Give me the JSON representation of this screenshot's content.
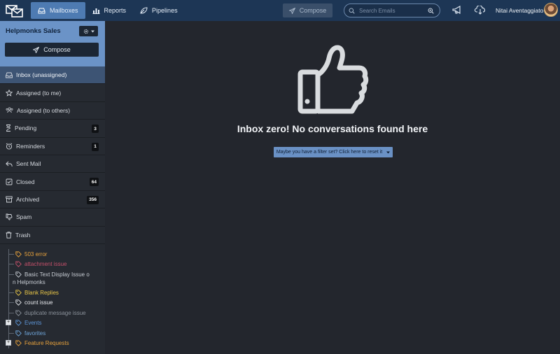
{
  "topbar": {
    "nav": [
      {
        "label": "Mailboxes",
        "icon": "inbox-icon",
        "active": true
      },
      {
        "label": "Reports",
        "icon": "bar-chart-icon",
        "active": false
      },
      {
        "label": "Pipelines",
        "icon": "leaf-icon",
        "active": false
      }
    ],
    "compose_label": "Compose",
    "search_placeholder": "Search Emails",
    "user_name": "Nitai Aventaggiato"
  },
  "sidebar": {
    "mailbox_title": "Helpmonks Sales",
    "compose_label": "Compose",
    "folders": [
      {
        "label": "Inbox (unassigned)",
        "icon": "inbox-icon",
        "count": null,
        "active": true
      },
      {
        "label": "Assigned (to me)",
        "icon": "star-icon",
        "count": null
      },
      {
        "label": "Assigned (to others)",
        "icon": "users-icon",
        "count": null
      },
      {
        "label": "Pending",
        "icon": "hourglass-icon",
        "count": "3"
      },
      {
        "label": "Reminders",
        "icon": "alarm-clock-icon",
        "count": "1"
      },
      {
        "label": "Sent Mail",
        "icon": "reply-icon",
        "count": null
      },
      {
        "label": "Closed",
        "icon": "check-square-icon",
        "count": "64"
      },
      {
        "label": "Archived",
        "icon": "archive-icon",
        "count": "356"
      },
      {
        "label": "Spam",
        "icon": "thumbs-down-icon",
        "count": null
      },
      {
        "label": "Trash",
        "icon": "trash-icon",
        "count": null
      }
    ],
    "tags": [
      {
        "label": "503 error",
        "color": "#e8a23c"
      },
      {
        "label": "attachment issue",
        "color": "#c4506a"
      },
      {
        "label": "Basic Text Display Issue o",
        "label2": "n Helpmonks",
        "color": "#c7ccd3"
      },
      {
        "label": "Blank Replies",
        "color": "#e8c547"
      },
      {
        "label": "count issue",
        "color": "#e6e8ec"
      },
      {
        "label": "duplicate message issue",
        "color": "#8b929b"
      },
      {
        "label": "Events",
        "color": "#5d95d6",
        "expandable": true
      },
      {
        "label": "favorites",
        "color": "#6ea4d8"
      },
      {
        "label": "Feature Requests",
        "color": "#e8a23c",
        "expandable": true
      }
    ]
  },
  "main": {
    "empty_title": "Inbox zero! No conversations found here",
    "reset_label": "Maybe you have a filter set? Click here to reset it"
  },
  "colors": {
    "topbar": "#1d3655",
    "accent": "#4e7bb2",
    "sidebar_head": "#6b93c7",
    "background": "#23262d"
  }
}
